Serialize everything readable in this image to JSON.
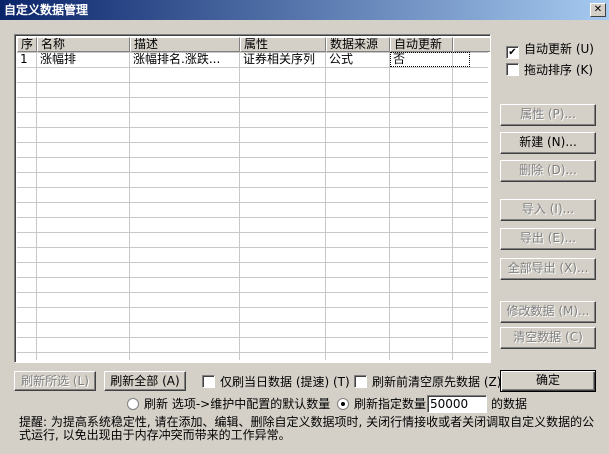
{
  "window": {
    "title": "自定义数据管理",
    "close_glyph": "✕"
  },
  "table": {
    "columns": [
      "序",
      "名称",
      "描述",
      "属性",
      "数据来源",
      "自动更新"
    ],
    "rows": [
      {
        "index": "1",
        "name": "涨幅排",
        "desc": "涨幅排名.涨跌...",
        "attr": "证券相关序列",
        "source": "公式",
        "auto_update": "否"
      }
    ]
  },
  "options": {
    "auto_update": {
      "label": "自动更新 (U)",
      "checked": true
    },
    "drag_sort": {
      "label": "拖动排序 (K)",
      "checked": false
    }
  },
  "side_buttons": {
    "properties": "属性 (P)...",
    "new": "新建 (N)...",
    "delete": "删除 (D)...",
    "import": "导入 (I)...",
    "export": "导出 (E)...",
    "export_all": "全部导出 (X)...",
    "modify_data": "修改数据 (M)...",
    "clear_data": "清空数据 (C)"
  },
  "bottom": {
    "refresh_selected": "刷新所选 (L)",
    "refresh_all": "刷新全部 (A)",
    "today_only": {
      "label": "仅刷当日数据 (提速) (T)",
      "checked": false
    },
    "clear_before_refresh": {
      "label": "刷新前清空原先数据 (Z)",
      "checked": false
    },
    "ok": "确定",
    "radio_default": {
      "label": "刷新 选项->维护中配置的默认数量",
      "selected": false
    },
    "radio_specified": {
      "label": "刷新指定数量",
      "selected": true
    },
    "count_value": "50000",
    "count_suffix": "的数据"
  },
  "tip": "提醒: 为提高系统稳定性, 请在添加、编辑、删除自定义数据项时, 关闭行情接收或者关闭调取自定义数据的公式运行, 以免出现由于内存冲突而带来的工作异常。"
}
